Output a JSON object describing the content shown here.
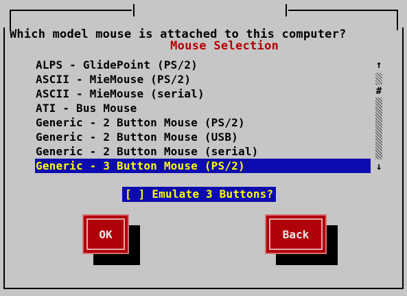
{
  "dialog": {
    "title": "Mouse Selection",
    "question": "Which model mouse is attached to this computer?"
  },
  "mouse_list": {
    "items": [
      "ALPS - GlidePoint (PS/2)",
      "ASCII - MieMouse (PS/2)",
      "ASCII - MieMouse (serial)",
      "ATI - Bus Mouse",
      "Generic - 2 Button Mouse (PS/2)",
      "Generic - 2 Button Mouse (USB)",
      "Generic - 2 Button Mouse (serial)",
      "Generic - 3 Button Mouse (PS/2)"
    ],
    "selected_index": 7
  },
  "scrollbar": {
    "up_glyph": "↑",
    "down_glyph": "↓",
    "thumb_glyph": "#"
  },
  "emulate_checkbox": {
    "label": "[ ] Emulate 3 Buttons?",
    "checked": false
  },
  "buttons": {
    "ok_label": "OK",
    "back_label": "Back"
  },
  "colors": {
    "background": "#c6c6c6",
    "title": "#b40000",
    "highlight_bg": "#0d0bb0",
    "highlight_fg": "#ffff00",
    "button": "#b0000a"
  }
}
